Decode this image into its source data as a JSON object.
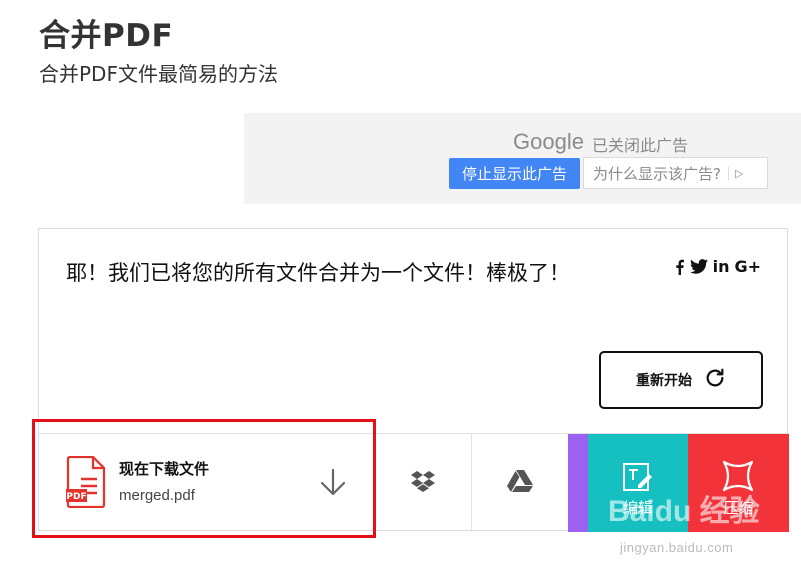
{
  "header": {
    "title": "合并PDF",
    "subtitle": "合并PDF文件最简易的方法"
  },
  "ad": {
    "brand": "Google",
    "status": "已关闭此广告",
    "stop_button": "停止显示此广告",
    "why_button": "为什么显示该广告?"
  },
  "result": {
    "message": "耶！我们已将您的所有文件合并为一个文件！棒极了！",
    "share_icons": [
      "facebook-icon",
      "twitter-icon",
      "linkedin-icon",
      "google-plus-icon"
    ],
    "share_labels": {
      "linkedin": "in",
      "google_plus": "G+"
    },
    "restart_button": "重新开始"
  },
  "download": {
    "title": "现在下载文件",
    "filename": "merged.pdf",
    "file_icon_label": "PDF"
  },
  "tools": {
    "edit_label": "编辑",
    "compress_label": "压缩"
  },
  "watermark": {
    "logo": "Baidu 经验",
    "url": "jingyan.baidu.com"
  },
  "colors": {
    "ad_button_blue": "#4285f4",
    "edit_teal": "#16c0c0",
    "compress_red": "#f3333a",
    "accent_purple": "#9d61f2",
    "highlight_red": "#e3101a",
    "pdf_icon_red": "#e5322d"
  }
}
